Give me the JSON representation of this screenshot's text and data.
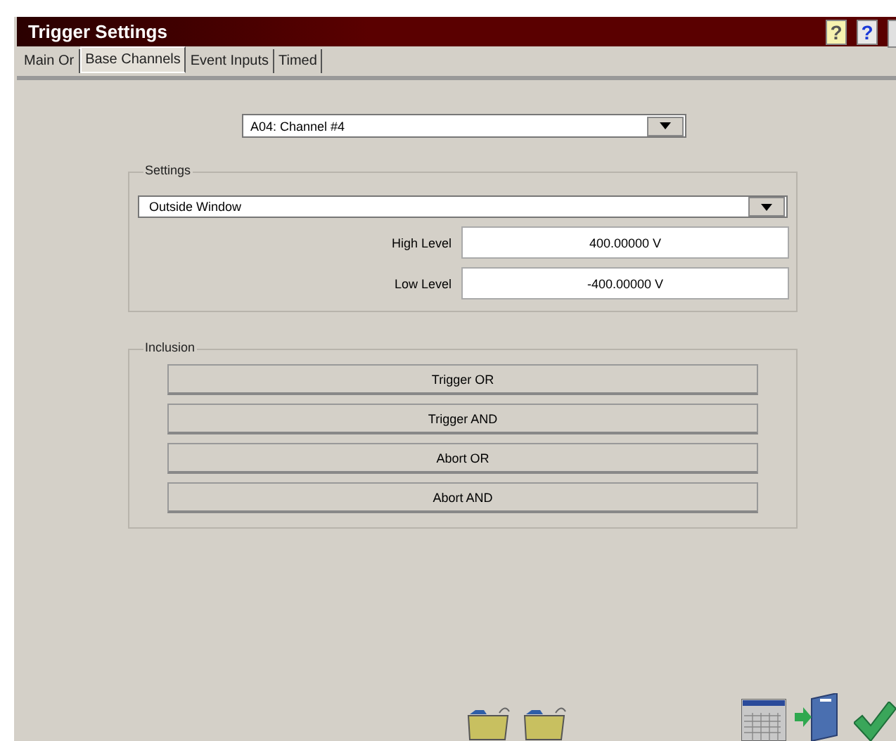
{
  "window": {
    "title": "Trigger Settings",
    "help_buttons": [
      {
        "kind": "balloon",
        "label": "?"
      },
      {
        "kind": "plain",
        "label": "?"
      }
    ]
  },
  "tabs": [
    {
      "label": "Main Or",
      "selected": false
    },
    {
      "label": "Base Channels",
      "selected": true
    },
    {
      "label": "Event Inputs",
      "selected": false
    },
    {
      "label": "Timed",
      "selected": false
    }
  ],
  "channel_select": {
    "value": "A04: Channel #4"
  },
  "settings": {
    "title": "Settings",
    "mode": "Outside Window",
    "fields": [
      {
        "label": "High Level",
        "value": "400.00000 V"
      },
      {
        "label": "Low Level",
        "value": "-400.00000 V"
      }
    ]
  },
  "inclusion": {
    "title": "Inclusion",
    "buttons": [
      "Trigger OR",
      "Trigger AND",
      "Abort OR",
      "Abort AND"
    ]
  }
}
